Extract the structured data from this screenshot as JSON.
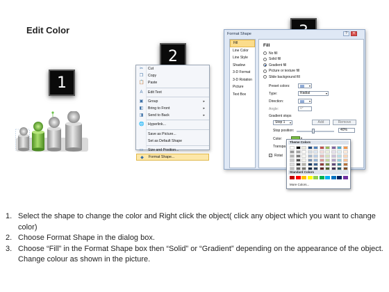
{
  "title": "Edit Color",
  "badges": [
    "1",
    "2",
    "3"
  ],
  "context_menu": {
    "items": [
      {
        "label": "Cut",
        "icon": "scissors-icon",
        "glyph": "✂",
        "submenu": false
      },
      {
        "label": "Copy",
        "icon": "copy-icon",
        "glyph": "❐",
        "submenu": false
      },
      {
        "label": "Paste",
        "icon": "clipboard-icon",
        "glyph": "📋",
        "submenu": false
      },
      {
        "label": "Edit Text",
        "icon": "edit-text-icon",
        "glyph": "A",
        "submenu": false
      },
      {
        "label": "Group",
        "icon": "group-icon",
        "glyph": "▣",
        "submenu": true
      },
      {
        "label": "Bring to Front",
        "icon": "bring-front-icon",
        "glyph": "◧",
        "submenu": true
      },
      {
        "label": "Send to Back",
        "icon": "send-back-icon",
        "glyph": "◨",
        "submenu": true
      },
      {
        "label": "Hyperlink...",
        "icon": "hyperlink-icon",
        "glyph": "🌐",
        "submenu": false
      },
      {
        "label": "Save as Picture...",
        "icon": "",
        "glyph": "",
        "submenu": false
      },
      {
        "label": "Set as Default Shape",
        "icon": "",
        "glyph": "",
        "submenu": false
      },
      {
        "label": "Size and Position...",
        "icon": "size-position-icon",
        "glyph": "▭",
        "submenu": false
      },
      {
        "label": "Format Shape...",
        "icon": "format-shape-icon",
        "glyph": "◆",
        "submenu": false
      }
    ]
  },
  "dialog": {
    "title": "Format Shape",
    "nav": [
      "Fill",
      "Line Color",
      "Line Style",
      "Shadow",
      "3-D Format",
      "3-D Rotation",
      "Picture",
      "Text Box"
    ],
    "fill_heading": "Fill",
    "fill_options": [
      "No fill",
      "Solid fill",
      "Gradient fill",
      "Picture or texture fill",
      "Slide background fill"
    ],
    "preset_colors_label": "Preset colors:",
    "type_label": "Type:",
    "type_value": "Radial",
    "direction_label": "Direction:",
    "angle_label": "Angle:",
    "angle_value": "0°",
    "gradient_stops_label": "Gradient stops",
    "stop_value": "Stop 1",
    "add_label": "Add",
    "remove_label": "Remove",
    "stop_position_label": "Stop position:",
    "stop_position_value": "40%",
    "color_label": "Color:",
    "transparency_label": "Transpa",
    "rotate_label": "Rotat",
    "help_glyph": "?",
    "close_glyph": "✕"
  },
  "palette": {
    "theme_label": "Theme Colors",
    "standard_label": "Standard Colors",
    "more_label": "More Colors...",
    "theme_top": [
      "#ffffff",
      "#000000",
      "#eeece1",
      "#1f497d",
      "#4f81bd",
      "#c0504d",
      "#9bbb59",
      "#8064a2",
      "#4bacc6",
      "#f79646"
    ],
    "standard": [
      "#c00000",
      "#ff0000",
      "#ffc000",
      "#ffff00",
      "#92d050",
      "#00b050",
      "#00b0f0",
      "#0070c0",
      "#002060",
      "#7030a0"
    ]
  },
  "instructions": [
    {
      "num": "1.",
      "text": "Select the shape to change the color and Right click the object( click any object which you want to change color)"
    },
    {
      "num": "2.",
      "text": "Choose Format Shape in the dialog box."
    },
    {
      "num": "3.",
      "text": "Choose “Fill” in the Format Shape box then “Solid” or “Gradient” depending on the appearance of the object. Change colour as shown in the picture."
    }
  ],
  "colors": {
    "selected_shape": "#7bc043",
    "gray_shape": "#b9b9b9"
  }
}
